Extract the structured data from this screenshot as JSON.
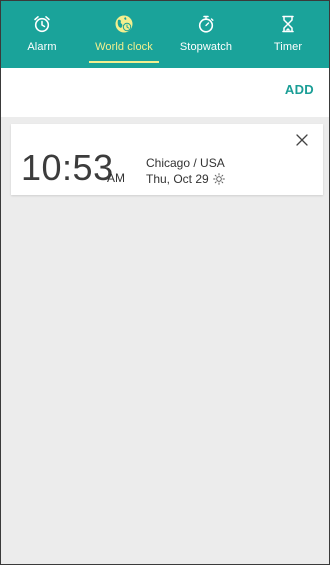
{
  "tabs": [
    {
      "label": "Alarm",
      "icon": "alarm-clock-icon",
      "active": false
    },
    {
      "label": "World clock",
      "icon": "globe-clock-icon",
      "active": true
    },
    {
      "label": "Stopwatch",
      "icon": "stopwatch-icon",
      "active": false
    },
    {
      "label": "Timer",
      "icon": "hourglass-icon",
      "active": false
    }
  ],
  "toolbar": {
    "add_label": "ADD"
  },
  "clocks": [
    {
      "time": "10:53",
      "ampm": "AM",
      "city": "Chicago / USA",
      "date": "Thu, Oct 29",
      "daylight_icon": "sun-icon"
    }
  ],
  "colors": {
    "accent": "#1aa39a",
    "active_tab": "#f3ef8e",
    "add_text": "#1a9e96",
    "background": "#ececec"
  }
}
